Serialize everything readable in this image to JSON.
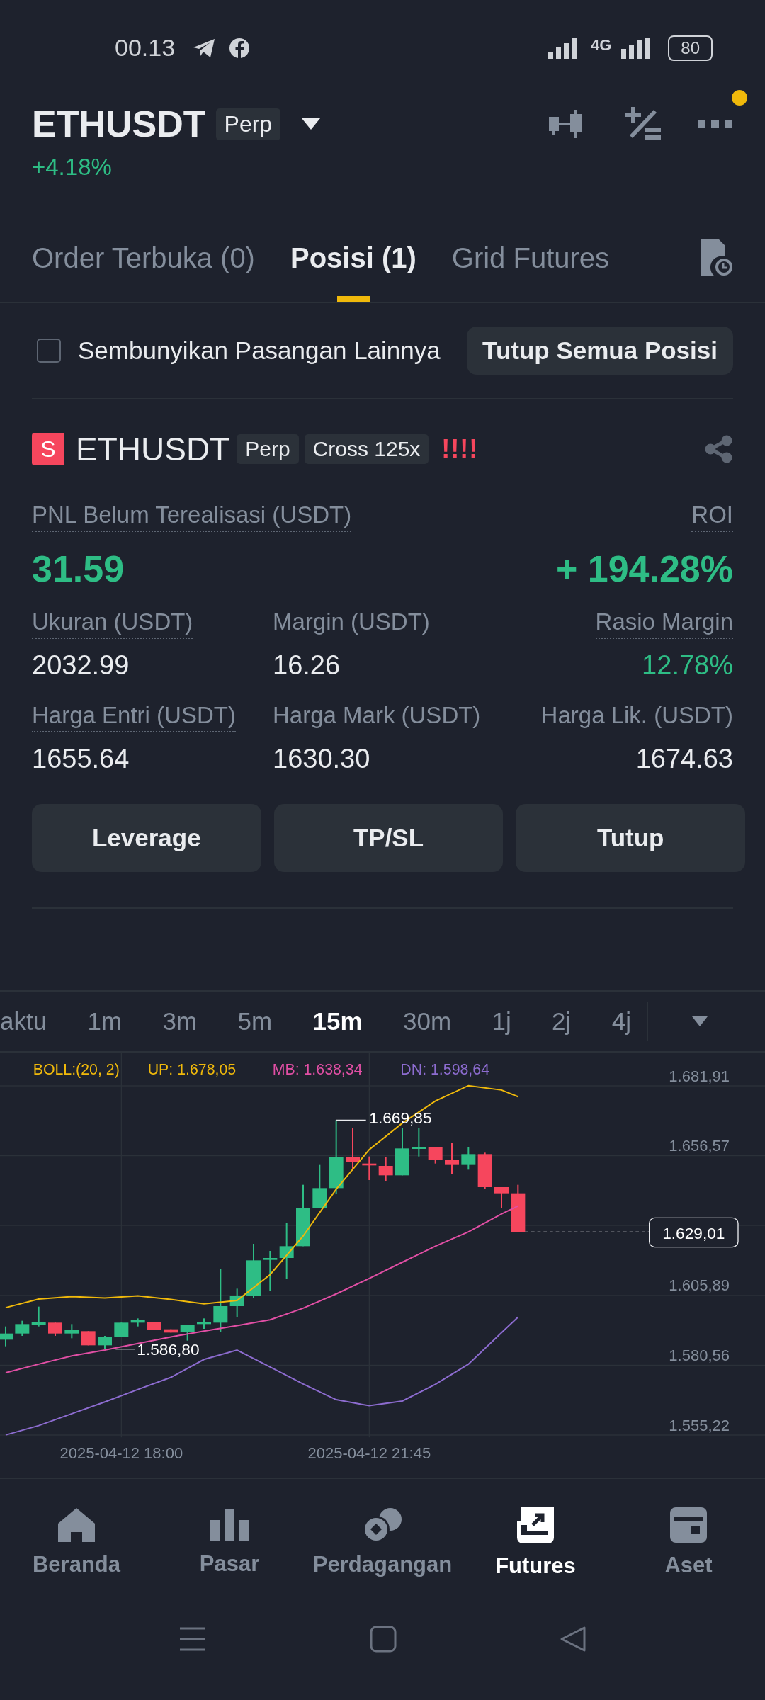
{
  "status_bar": {
    "time": "00.13",
    "network": "4G",
    "battery": "80"
  },
  "header": {
    "symbol": "ETHUSDT",
    "tag": "Perp",
    "change": "+4.18%",
    "notification": true
  },
  "tabs": [
    {
      "label": "Order Terbuka (0)",
      "selected": false
    },
    {
      "label": "Posisi (1)",
      "selected": true
    },
    {
      "label": "Grid Futures",
      "selected": false
    }
  ],
  "filter": {
    "label": "Sembunyikan Pasangan Lainnya",
    "checked": false,
    "button": "Tutup Semua Posisi"
  },
  "position": {
    "side": "S",
    "symbol": "ETHUSDT",
    "tags": [
      "Perp",
      "Cross 125x"
    ],
    "risk": "!!!!",
    "pnl_label": "PNL Belum Terealisasi (USDT)",
    "pnl": "31.59",
    "roi_label": "ROI",
    "roi": "+ 194.28%",
    "stats": [
      {
        "label": "Ukuran (USDT)",
        "value": "2032.99",
        "underlined": true,
        "positive": false
      },
      {
        "label": "Margin (USDT)",
        "value": "16.26",
        "underlined": false,
        "positive": false
      },
      {
        "label": "Rasio Margin",
        "value": "12.78%",
        "underlined": true,
        "positive": true
      },
      {
        "label": "Harga Entri (USDT)",
        "value": "1655.64",
        "underlined": true,
        "positive": false
      },
      {
        "label": "Harga Mark (USDT)",
        "value": "1630.30",
        "underlined": false,
        "positive": false
      },
      {
        "label": "Harga Lik. (USDT)",
        "value": "1674.63",
        "underlined": false,
        "positive": false
      }
    ],
    "actions": [
      "Leverage",
      "TP/SL",
      "Tutup"
    ]
  },
  "intervals": [
    {
      "label": "aktu",
      "selected": false
    },
    {
      "label": "1m",
      "selected": false
    },
    {
      "label": "3m",
      "selected": false
    },
    {
      "label": "5m",
      "selected": false
    },
    {
      "label": "15m",
      "selected": true
    },
    {
      "label": "30m",
      "selected": false
    },
    {
      "label": "1j",
      "selected": false
    },
    {
      "label": "2j",
      "selected": false
    },
    {
      "label": "4j",
      "selected": false
    }
  ],
  "chart": {
    "legend": [
      {
        "text": "BOLL:(20, 2)",
        "color": "#f0b90b"
      },
      {
        "text": "UP: 1.678,05",
        "color": "#f0b90b"
      },
      {
        "text": "MB: 1.638,34",
        "color": "#e24fa5"
      },
      {
        "text": "DN: 1.598,64",
        "color": "#8d6cd0"
      }
    ],
    "price_scale": [
      "1.681,91",
      "1.656,57",
      "1.605,89",
      "1.580,56",
      "1.555,22"
    ],
    "time_labels": [
      "2025-04-12 18:00",
      "2025-04-12 21:45"
    ],
    "high_label": "1.669,85",
    "low_label": "1.586,80",
    "last_price": "1.629,01"
  },
  "bottom_nav": [
    {
      "label": "Beranda",
      "selected": false
    },
    {
      "label": "Pasar",
      "selected": false
    },
    {
      "label": "Perdagangan",
      "selected": false
    },
    {
      "label": "Futures",
      "selected": true
    },
    {
      "label": "Aset",
      "selected": false
    }
  ]
}
